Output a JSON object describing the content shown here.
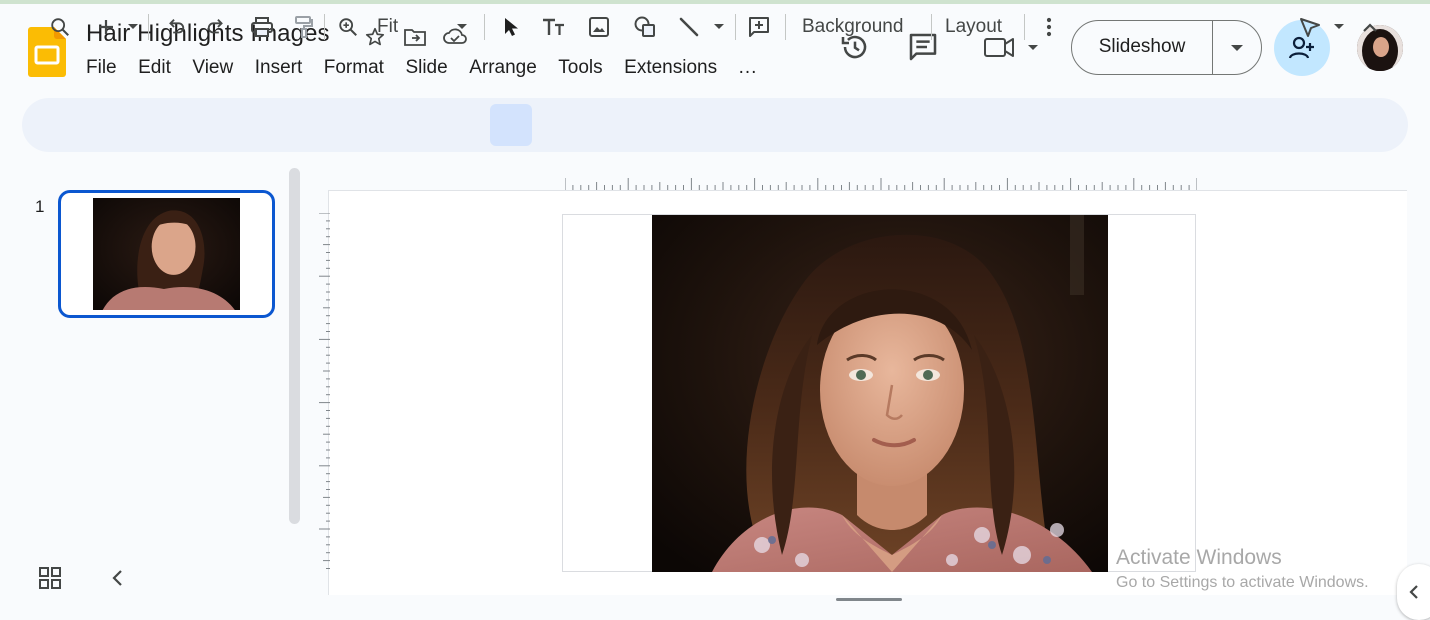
{
  "header": {
    "title": "Hair Highlights Images",
    "title_icons": [
      "star-icon",
      "move-to-folder-icon",
      "cloud-saved-icon"
    ],
    "menu": [
      "File",
      "Edit",
      "View",
      "Insert",
      "Format",
      "Slide",
      "Arrange",
      "Tools",
      "Extensions",
      "..."
    ],
    "right_icons": [
      "history-icon",
      "comment-icon",
      "video-call-icon"
    ],
    "slideshow_label": "Slideshow",
    "share_icon": "person-add-icon"
  },
  "toolbar": {
    "zoom_value": "Fit",
    "background_label": "Background",
    "layout_label": "Layout",
    "icons": [
      "search-icon",
      "new-slide-icon",
      "undo-icon",
      "redo-icon",
      "print-icon",
      "paint-format-icon",
      "zoom-icon",
      "select-icon",
      "text-box-icon",
      "image-icon",
      "shape-icon",
      "line-icon",
      "comment-add-icon",
      "more-vert-icon",
      "pen-icon",
      "collapse-up-icon"
    ],
    "accent": "#0b57d0"
  },
  "filmstrip": {
    "slides": [
      {
        "number": "1"
      }
    ]
  },
  "watermark": {
    "line1": "Activate Windows",
    "line2": "Go to Settings to activate Windows."
  }
}
